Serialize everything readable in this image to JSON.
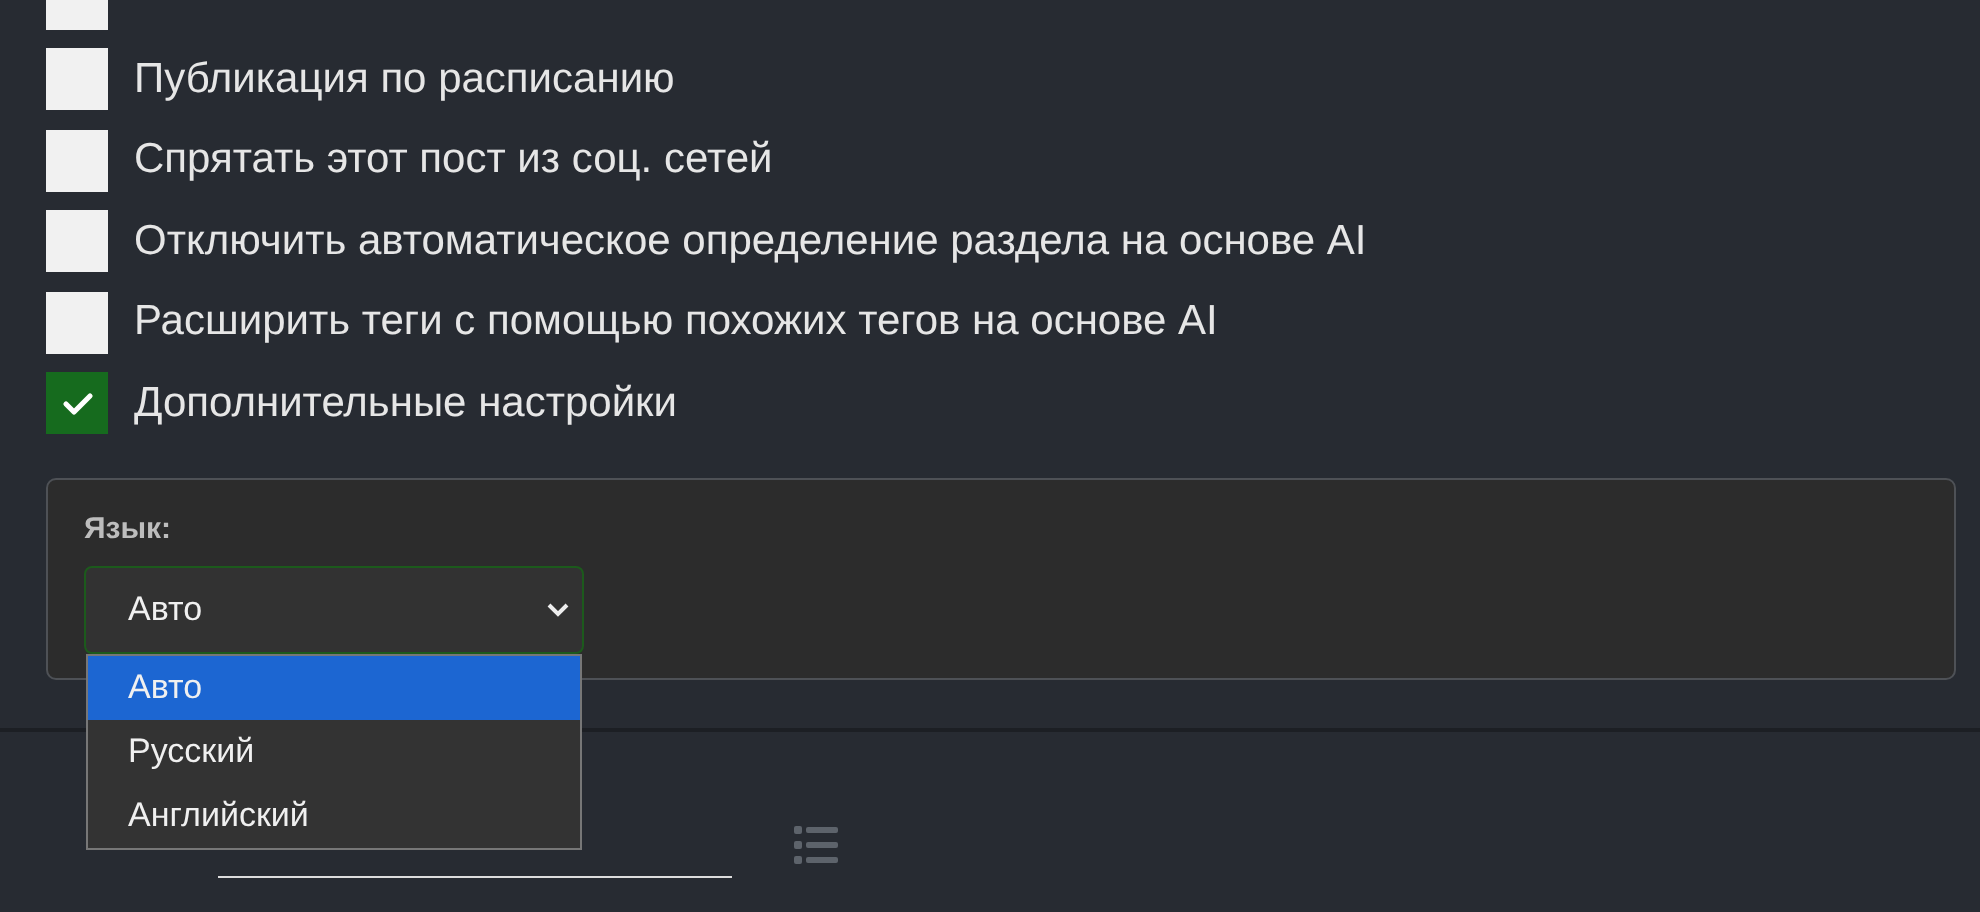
{
  "options": [
    {
      "checked": false
    },
    {
      "label": "Публикация по расписанию",
      "checked": false
    },
    {
      "label": "Спрятать этот пост из соц. сетей",
      "checked": false
    },
    {
      "label": "Отключить автоматическое определение раздела на основе AI",
      "checked": false
    },
    {
      "label": "Расширить теги с помощью похожих тегов на основе AI",
      "checked": false
    },
    {
      "label": "Дополнительные настройки",
      "checked": true
    }
  ],
  "advanced": {
    "language_label": "Язык:",
    "language_value": "Авто",
    "expanded": true,
    "language_options": [
      {
        "label": "Авто",
        "selected": true
      },
      {
        "label": "Русский",
        "selected": false
      },
      {
        "label": "Английский",
        "selected": false
      }
    ]
  },
  "section": {
    "kind": "input"
  }
}
